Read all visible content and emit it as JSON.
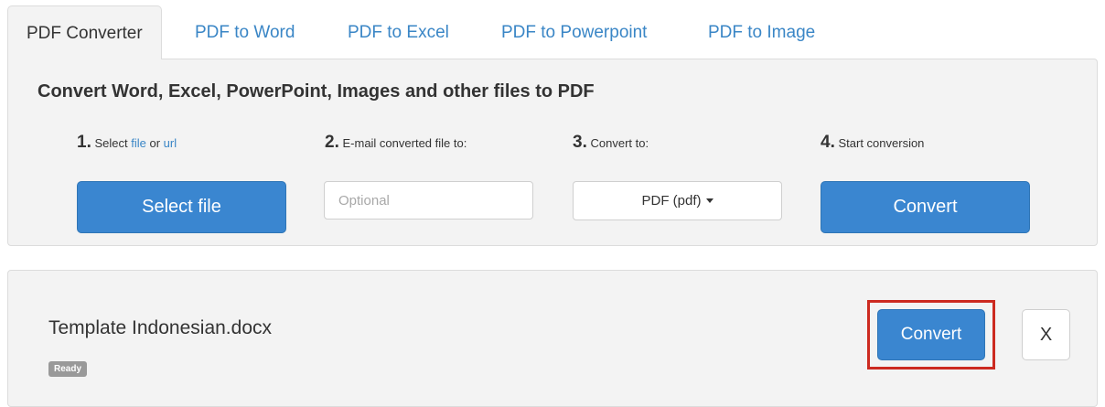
{
  "tabs": [
    {
      "label": "PDF Converter",
      "active": true
    },
    {
      "label": "PDF to Word"
    },
    {
      "label": "PDF to Excel"
    },
    {
      "label": "PDF to Powerpoint"
    },
    {
      "label": "PDF to Image"
    }
  ],
  "converter": {
    "title": "Convert Word, Excel, PowerPoint, Images and other files to PDF",
    "steps": [
      {
        "num": "1.",
        "text": "Select ",
        "link1": "file",
        "mid": " or ",
        "link2": "url"
      },
      {
        "num": "2.",
        "text": "E-mail converted file to:"
      },
      {
        "num": "3.",
        "text": "Convert to:"
      },
      {
        "num": "4.",
        "text": "Start conversion"
      }
    ],
    "select_file_label": "Select file",
    "email_placeholder": "Optional",
    "format_value": "PDF (pdf)",
    "convert_label": "Convert"
  },
  "file": {
    "name": "Template Indonesian.docx",
    "status": "Ready",
    "convert_label": "Convert",
    "remove_label": "X"
  },
  "colors": {
    "accent": "#3a86d0",
    "link": "#3a86c6",
    "highlight": "#cc2a20",
    "panel": "#f3f3f3"
  }
}
